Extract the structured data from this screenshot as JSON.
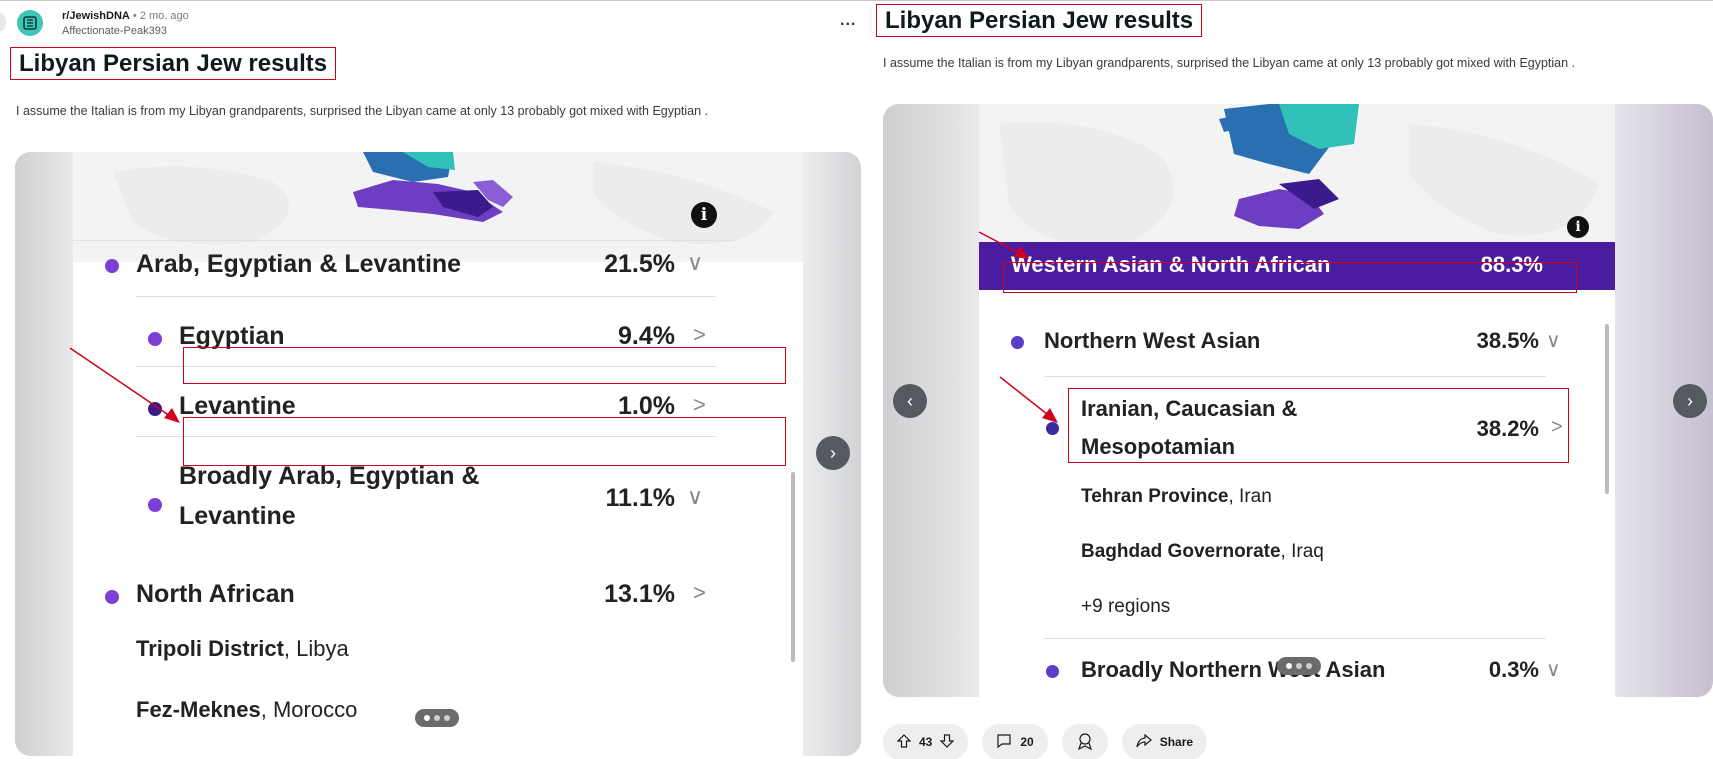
{
  "left_post": {
    "subreddit": "r/JewishDNA",
    "separator": "•",
    "time": "2 mo. ago",
    "author": "Affectionate-Peak393",
    "title": "Libyan Persian Jew results",
    "body": "I assume the Italian is from my Libyan grandparents, surprised the Libyan came at only 13 probably got mixed with Egyptian .",
    "screenshot": {
      "rows": [
        {
          "label": "Arab, Egyptian & Levantine",
          "pct": "21.5%",
          "chevron": "∨"
        },
        {
          "label": "Egyptian",
          "pct": "9.4%",
          "chevron": ">"
        },
        {
          "label": "Levantine",
          "pct": "1.0%",
          "chevron": ">"
        },
        {
          "label_line1": "Broadly Arab, Egyptian &",
          "label_line2": "Levantine",
          "pct": "11.1%",
          "chevron": "∨"
        },
        {
          "label": "North African",
          "pct": "13.1%",
          "chevron": ">"
        }
      ],
      "regions": [
        {
          "bold": "Tripoli District",
          "rest": ", Libya"
        },
        {
          "bold": "Fez-Meknes",
          "rest": ", Morocco"
        }
      ]
    }
  },
  "right_post": {
    "menu": "...",
    "title": "Libyan Persian Jew results",
    "body": "I assume the Italian is from my Libyan grandparents, surprised the Libyan came at only 13 probably got mixed with Egyptian .",
    "screenshot": {
      "header": {
        "label": "Western Asian & North African",
        "pct": "88.3%"
      },
      "rows": [
        {
          "label": "Northern West Asian",
          "pct": "38.5%",
          "chevron": "∨"
        },
        {
          "label_line1": "Iranian, Caucasian &",
          "label_line2": "Mesopotamian",
          "pct": "38.2%",
          "chevron": ">"
        },
        {
          "label": "Broadly Northern West Asian",
          "pct": "0.3%",
          "chevron": "∨"
        }
      ],
      "regions": [
        {
          "bold": "Tehran Province",
          "rest": ", Iran"
        },
        {
          "bold": "Baghdad Governorate",
          "rest": ", Iraq"
        },
        {
          "bold": "",
          "rest": "+9 regions"
        }
      ]
    },
    "actions": {
      "upvotes": "43",
      "comments": "20",
      "share": "Share"
    }
  },
  "colors": {
    "red_annotation": "#d0021b",
    "purple": "#4b1ba0",
    "bullet_purple": "#7b3fd6",
    "bullet_dark": "#3a1a8a"
  }
}
